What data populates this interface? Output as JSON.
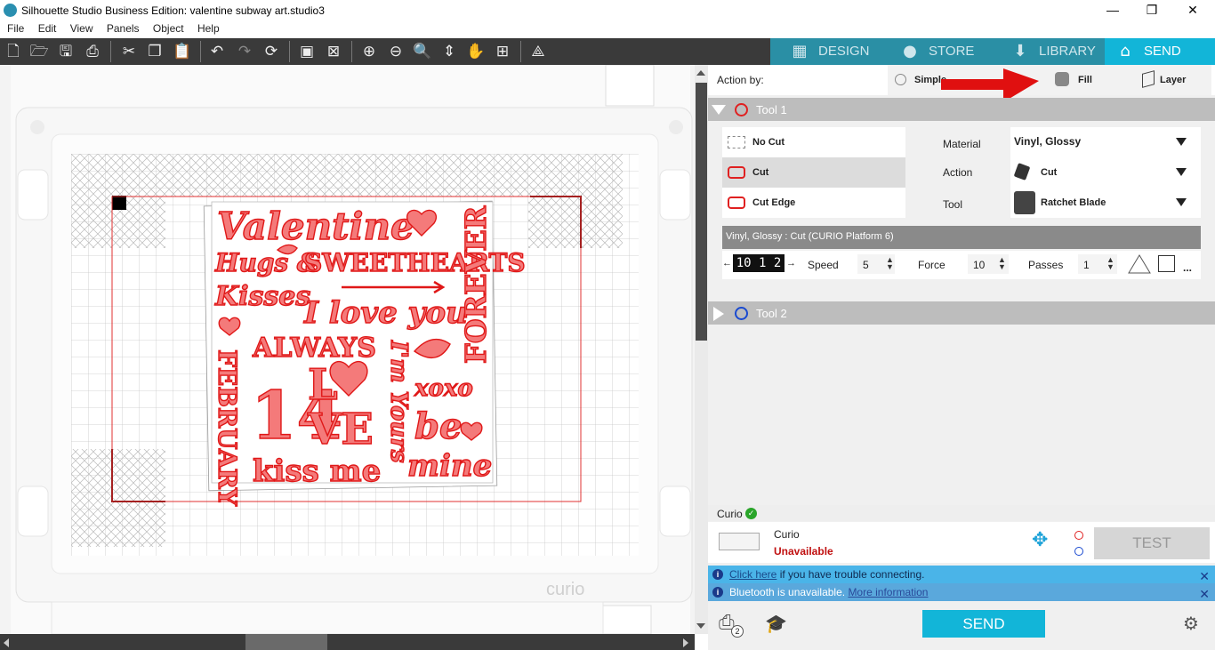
{
  "window": {
    "title": "Silhouette Studio Business Edition: valentine subway art.studio3",
    "minimize": "—",
    "restore": "❐",
    "close": "✕"
  },
  "menu": [
    "File",
    "Edit",
    "View",
    "Panels",
    "Object",
    "Help"
  ],
  "nav_tabs": [
    {
      "label": "DESIGN",
      "icon": "grid-icon"
    },
    {
      "label": "STORE",
      "icon": "silhouette-s-icon"
    },
    {
      "label": "LIBRARY",
      "icon": "library-icon"
    },
    {
      "label": "SEND",
      "icon": "send-icon"
    }
  ],
  "panel": {
    "action_by_label": "Action by:",
    "action_modes": [
      "Simple",
      "Fill",
      "Layer"
    ],
    "tool1": {
      "name": "Tool 1",
      "color": "#e02020",
      "cut_options": [
        "No Cut",
        "Cut",
        "Cut Edge"
      ],
      "selected_cut": "Cut",
      "material_label": "Material",
      "material_value": "Vinyl, Glossy",
      "action_label": "Action",
      "action_value": "Cut",
      "tool_label": "Tool",
      "tool_value": "Ratchet Blade",
      "summary": "Vinyl, Glossy : Cut (CURIO Platform 6)",
      "blade_digits": "10 1 2",
      "speed_label": "Speed",
      "speed_value": "5",
      "force_label": "Force",
      "force_value": "10",
      "passes_label": "Passes",
      "passes_value": "1",
      "more": "..."
    },
    "tool2": {
      "name": "Tool 2",
      "color": "#1a4ad0"
    },
    "device": {
      "section_label": "Curio",
      "name": "Curio",
      "status": "Unavailable",
      "test_label": "TEST"
    },
    "info1": {
      "link": "Click here",
      "text": " if you have trouble connecting."
    },
    "info2": {
      "text": "Bluetooth is unavailable. ",
      "link": "More information"
    },
    "send_label": "SEND",
    "queue_badge": "2"
  },
  "mat": {
    "brand": "curio",
    "design_words": [
      "Valentine",
      "Hugs &",
      "Kisses",
      "SWEETHEARTS",
      "I love you",
      "FOREVER",
      "ALWAYS",
      "I'm Yours",
      "FEBRUARY",
      "14",
      "L",
      "VE",
      "xoxo",
      "be",
      "mine",
      "kiss me"
    ]
  }
}
